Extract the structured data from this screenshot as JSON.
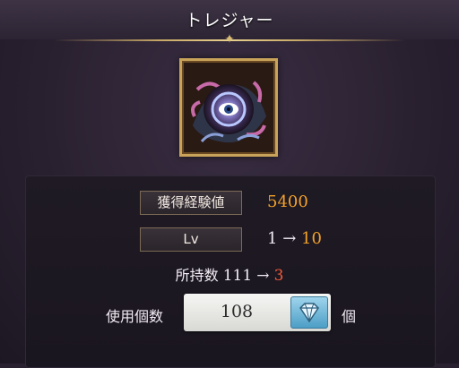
{
  "header": {
    "title": "トレジャー"
  },
  "item": {
    "icon": "treasure-eye-orb-icon"
  },
  "exp": {
    "label": "獲得経験値",
    "value": "5400"
  },
  "level": {
    "label": "Lv",
    "from": "1",
    "arrow": "→",
    "to": "10"
  },
  "owned": {
    "label": "所持数",
    "from": "111",
    "arrow": "→",
    "to": "3"
  },
  "use": {
    "label": "使用個数",
    "quantity": "108",
    "unit": "個",
    "button_icon": "diamond-dropdown-icon"
  },
  "colors": {
    "accent_orange": "#f4a22a",
    "accent_red": "#f25a3a",
    "gold": "#c9a35a",
    "stepper_blue": "#4c9ec6"
  }
}
